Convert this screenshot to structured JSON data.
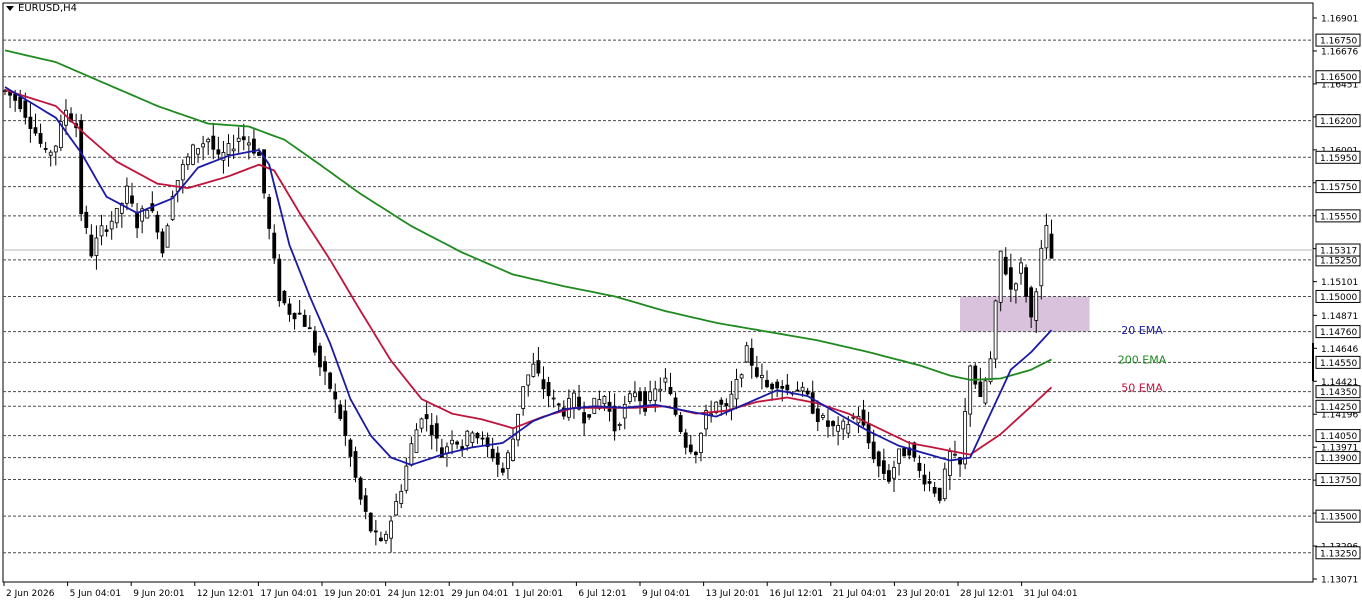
{
  "symbol": "EURUSD,H4",
  "chart_data": {
    "type": "candlestick",
    "title": "EURUSD,H4",
    "ylim": [
      1.1307,
      1.1702
    ],
    "price_ticks": [
      "1.16901",
      "1.16676",
      "1.16451",
      "1.16226",
      "1.16001",
      "1.15776",
      "1.15551",
      "1.15326",
      "1.15101",
      "1.14871",
      "1.14646",
      "1.14421",
      "1.14196",
      "1.13971",
      "1.13746",
      "1.13521",
      "1.13296",
      "1.13071"
    ],
    "x_labels": [
      "2 Jun 2026",
      "5 Jun 04:01",
      "9 Jun 20:01",
      "12 Jun 12:01",
      "17 Jun 04:01",
      "19 Jun 20:01",
      "24 Jun 12:01",
      "29 Jun 04:01",
      "1 Jul 20:01",
      "6 Jul 12:01",
      "9 Jul 04:01",
      "13 Jul 20:01",
      "16 Jul 12:01",
      "21 Jul 04:01",
      "23 Jul 20:01",
      "28 Jul 12:01",
      "31 Jul 04:01"
    ],
    "levels": [
      {
        "label": "1.16750",
        "value": 1.1675
      },
      {
        "label": "1.16500",
        "value": 1.165
      },
      {
        "label": "1.16200",
        "value": 1.162
      },
      {
        "label": "1.15950",
        "value": 1.1595
      },
      {
        "label": "1.15750",
        "value": 1.1575
      },
      {
        "label": "1.15550",
        "value": 1.1555
      },
      {
        "label": "1.15250",
        "value": 1.1525
      },
      {
        "label": "1.15000",
        "value": 1.15
      },
      {
        "label": "1.14760",
        "value": 1.1476
      },
      {
        "label": "1.14550",
        "value": 1.1455
      },
      {
        "label": "1.14350",
        "value": 1.1435
      },
      {
        "label": "1.14250",
        "value": 1.1425
      },
      {
        "label": "1.14050",
        "value": 1.1405
      },
      {
        "label": "1.13900",
        "value": 1.139
      },
      {
        "label": "1.13750",
        "value": 1.1375
      },
      {
        "label": "1.13500",
        "value": 1.135
      },
      {
        "label": "1.13250",
        "value": 1.1325
      }
    ],
    "current_price": {
      "label": "1.15317",
      "value": 1.15317
    },
    "zone": {
      "from": 1.1476,
      "to": 1.15
    },
    "ema_labels": [
      {
        "text": "20 EMA",
        "color": "#1a1aa6",
        "value": 1.1477
      },
      {
        "text": "200 EMA",
        "color": "#1f8a1f",
        "value": 1.1457
      },
      {
        "text": "50 EMA",
        "color": "#c0143c",
        "value": 1.1438
      }
    ],
    "path_points": [
      [
        0,
        1.164
      ],
      [
        3,
        1.1632
      ],
      [
        6,
        1.1612
      ],
      [
        8,
        1.1596
      ],
      [
        10,
        1.1604
      ],
      [
        12,
        1.1628
      ],
      [
        14,
        1.1616
      ],
      [
        15,
        1.1558
      ],
      [
        17,
        1.153
      ],
      [
        19,
        1.1545
      ],
      [
        22,
        1.1556
      ],
      [
        24,
        1.1572
      ],
      [
        26,
        1.155
      ],
      [
        28,
        1.1563
      ],
      [
        30,
        1.1548
      ],
      [
        31,
        1.1531
      ],
      [
        33,
        1.1572
      ],
      [
        35,
        1.1588
      ],
      [
        37,
        1.16
      ],
      [
        40,
        1.1608
      ],
      [
        42,
        1.1593
      ],
      [
        44,
        1.16
      ],
      [
        46,
        1.1609
      ],
      [
        48,
        1.1606
      ],
      [
        50,
        1.1596
      ],
      [
        52,
        1.1545
      ],
      [
        54,
        1.15
      ],
      [
        56,
        1.149
      ],
      [
        58,
        1.1488
      ],
      [
        60,
        1.1476
      ],
      [
        62,
        1.1452
      ],
      [
        64,
        1.1438
      ],
      [
        66,
        1.1418
      ],
      [
        68,
        1.139
      ],
      [
        70,
        1.1361
      ],
      [
        72,
        1.1341
      ],
      [
        74,
        1.133
      ],
      [
        76,
        1.1348
      ],
      [
        78,
        1.137
      ],
      [
        80,
        1.1398
      ],
      [
        82,
        1.142
      ],
      [
        84,
        1.141
      ],
      [
        86,
        1.1392
      ],
      [
        88,
        1.1405
      ],
      [
        90,
        1.1398
      ],
      [
        92,
        1.141
      ],
      [
        94,
        1.14
      ],
      [
        96,
        1.1392
      ],
      [
        98,
        1.138
      ],
      [
        100,
        1.1403
      ],
      [
        102,
        1.144
      ],
      [
        104,
        1.1452
      ],
      [
        106,
        1.1438
      ],
      [
        108,
        1.1428
      ],
      [
        110,
        1.1422
      ],
      [
        112,
        1.143
      ],
      [
        114,
        1.1418
      ],
      [
        116,
        1.1426
      ],
      [
        118,
        1.1432
      ],
      [
        120,
        1.141
      ],
      [
        122,
        1.1424
      ],
      [
        124,
        1.1436
      ],
      [
        126,
        1.1426
      ],
      [
        128,
        1.1435
      ],
      [
        130,
        1.1442
      ],
      [
        132,
        1.142
      ],
      [
        134,
        1.14
      ],
      [
        136,
        1.1395
      ],
      [
        138,
        1.1418
      ],
      [
        140,
        1.1428
      ],
      [
        142,
        1.1422
      ],
      [
        144,
        1.144
      ],
      [
        146,
        1.1462
      ],
      [
        148,
        1.1448
      ],
      [
        150,
        1.1438
      ],
      [
        152,
        1.1442
      ],
      [
        154,
        1.1436
      ],
      [
        156,
        1.1438
      ],
      [
        158,
        1.143
      ],
      [
        160,
        1.1418
      ],
      [
        162,
        1.1412
      ],
      [
        164,
        1.1408
      ],
      [
        166,
        1.1414
      ],
      [
        168,
        1.142
      ],
      [
        170,
        1.14
      ],
      [
        172,
        1.1384
      ],
      [
        174,
        1.1376
      ],
      [
        176,
        1.1392
      ],
      [
        178,
        1.1396
      ],
      [
        180,
        1.138
      ],
      [
        182,
        1.1372
      ],
      [
        184,
        1.1364
      ],
      [
        186,
        1.1392
      ],
      [
        188,
        1.1384
      ],
      [
        190,
        1.1455
      ],
      [
        192,
        1.1428
      ],
      [
        194,
        1.1456
      ],
      [
        196,
        1.153
      ],
      [
        198,
        1.1505
      ],
      [
        200,
        1.152
      ],
      [
        202,
        1.1485
      ],
      [
        204,
        1.153
      ],
      [
        205,
        1.1545
      ],
      [
        206,
        1.1526
      ]
    ],
    "ema20_points": [
      [
        0,
        1.1643
      ],
      [
        10,
        1.1622
      ],
      [
        15,
        1.1598
      ],
      [
        20,
        1.1568
      ],
      [
        26,
        1.1557
      ],
      [
        33,
        1.1567
      ],
      [
        38,
        1.1588
      ],
      [
        44,
        1.1596
      ],
      [
        50,
        1.16
      ],
      [
        52,
        1.159
      ],
      [
        56,
        1.1535
      ],
      [
        60,
        1.15
      ],
      [
        64,
        1.1468
      ],
      [
        68,
        1.143
      ],
      [
        72,
        1.1405
      ],
      [
        76,
        1.139
      ],
      [
        80,
        1.1385
      ],
      [
        86,
        1.1392
      ],
      [
        92,
        1.1397
      ],
      [
        98,
        1.14
      ],
      [
        104,
        1.1415
      ],
      [
        110,
        1.1423
      ],
      [
        116,
        1.1425
      ],
      [
        122,
        1.1424
      ],
      [
        128,
        1.1426
      ],
      [
        134,
        1.1422
      ],
      [
        140,
        1.1418
      ],
      [
        146,
        1.1427
      ],
      [
        152,
        1.1436
      ],
      [
        158,
        1.1432
      ],
      [
        164,
        1.142
      ],
      [
        170,
        1.1408
      ],
      [
        176,
        1.1398
      ],
      [
        182,
        1.1392
      ],
      [
        186,
        1.1388
      ],
      [
        190,
        1.139
      ],
      [
        194,
        1.142
      ],
      [
        198,
        1.145
      ],
      [
        202,
        1.1462
      ],
      [
        206,
        1.1477
      ]
    ],
    "ema50_points": [
      [
        0,
        1.1641
      ],
      [
        10,
        1.163
      ],
      [
        16,
        1.161
      ],
      [
        22,
        1.1592
      ],
      [
        30,
        1.1577
      ],
      [
        36,
        1.1574
      ],
      [
        44,
        1.1582
      ],
      [
        50,
        1.159
      ],
      [
        53,
        1.1586
      ],
      [
        58,
        1.1557
      ],
      [
        64,
        1.1525
      ],
      [
        70,
        1.149
      ],
      [
        76,
        1.1456
      ],
      [
        82,
        1.143
      ],
      [
        88,
        1.142
      ],
      [
        94,
        1.1416
      ],
      [
        100,
        1.141
      ],
      [
        106,
        1.1418
      ],
      [
        112,
        1.1424
      ],
      [
        118,
        1.1424
      ],
      [
        124,
        1.1424
      ],
      [
        130,
        1.1425
      ],
      [
        136,
        1.142
      ],
      [
        142,
        1.1422
      ],
      [
        148,
        1.1428
      ],
      [
        154,
        1.1431
      ],
      [
        160,
        1.1427
      ],
      [
        166,
        1.142
      ],
      [
        172,
        1.141
      ],
      [
        178,
        1.14
      ],
      [
        184,
        1.1396
      ],
      [
        190,
        1.1392
      ],
      [
        196,
        1.1406
      ],
      [
        202,
        1.1425
      ],
      [
        206,
        1.1438
      ]
    ],
    "ema200_points": [
      [
        0,
        1.1668
      ],
      [
        10,
        1.166
      ],
      [
        20,
        1.1645
      ],
      [
        30,
        1.163
      ],
      [
        40,
        1.1618
      ],
      [
        48,
        1.1616
      ],
      [
        55,
        1.1607
      ],
      [
        62,
        1.159
      ],
      [
        70,
        1.157
      ],
      [
        80,
        1.1548
      ],
      [
        90,
        1.153
      ],
      [
        100,
        1.1515
      ],
      [
        110,
        1.1507
      ],
      [
        120,
        1.15
      ],
      [
        130,
        1.149
      ],
      [
        140,
        1.1482
      ],
      [
        150,
        1.1476
      ],
      [
        160,
        1.147
      ],
      [
        170,
        1.1462
      ],
      [
        180,
        1.1453
      ],
      [
        186,
        1.1446
      ],
      [
        190,
        1.1443
      ],
      [
        196,
        1.1444
      ],
      [
        202,
        1.145
      ],
      [
        206,
        1.1457
      ]
    ]
  },
  "colors": {
    "background": "#ffffff",
    "grid": "#4a4a4a",
    "candle": "#000000",
    "ema20": "#1a1aa6",
    "ema50": "#c0143c",
    "ema200": "#1f8a1f",
    "zone": "#d9c2dc",
    "current_line": "#b8b8b8"
  }
}
